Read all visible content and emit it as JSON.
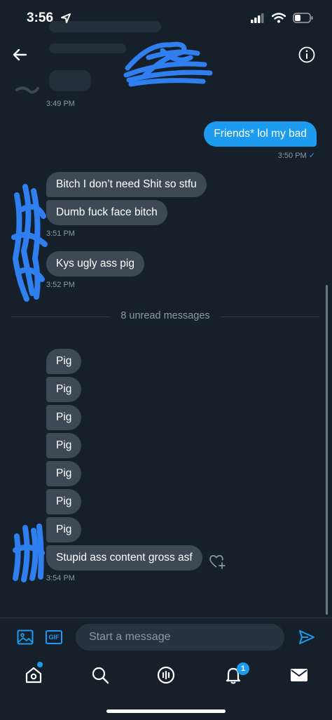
{
  "status_bar": {
    "time": "3:56"
  },
  "header": {
    "back_icon": "arrow-left-icon",
    "info_icon": "info-icon"
  },
  "messages": {
    "ts_0": "3:49 PM",
    "out_1": {
      "text": "Friends* lol my bad",
      "time": "3:50 PM",
      "check": "✓"
    },
    "in_1": "Bitch I don’t need Shit so stfu",
    "in_2": "Dumb fuck face bitch",
    "ts_1": "3:51 PM",
    "in_3": "Kys ugly ass pig",
    "ts_2": "3:52 PM",
    "unread": "8 unread messages",
    "pigs": [
      "Pig",
      "Pig",
      "Pig",
      "Pig",
      "Pig",
      "Pig",
      "Pig"
    ],
    "in_last": "Stupid ass content gross asf",
    "ts_3": "3:54 PM"
  },
  "compose": {
    "placeholder": "Start a message",
    "gif_label": "GIF",
    "image_icon": "image-icon",
    "send_icon": "send-icon"
  },
  "tabbar": {
    "notifications_badge": "1",
    "icons": [
      "home-icon",
      "search-icon",
      "spaces-icon",
      "notifications-icon",
      "messages-icon"
    ]
  },
  "colors": {
    "background": "#15202b",
    "accent": "#1d9bf0",
    "bubble_in": "#3d4a56",
    "scribble": "#2f7ff0"
  }
}
